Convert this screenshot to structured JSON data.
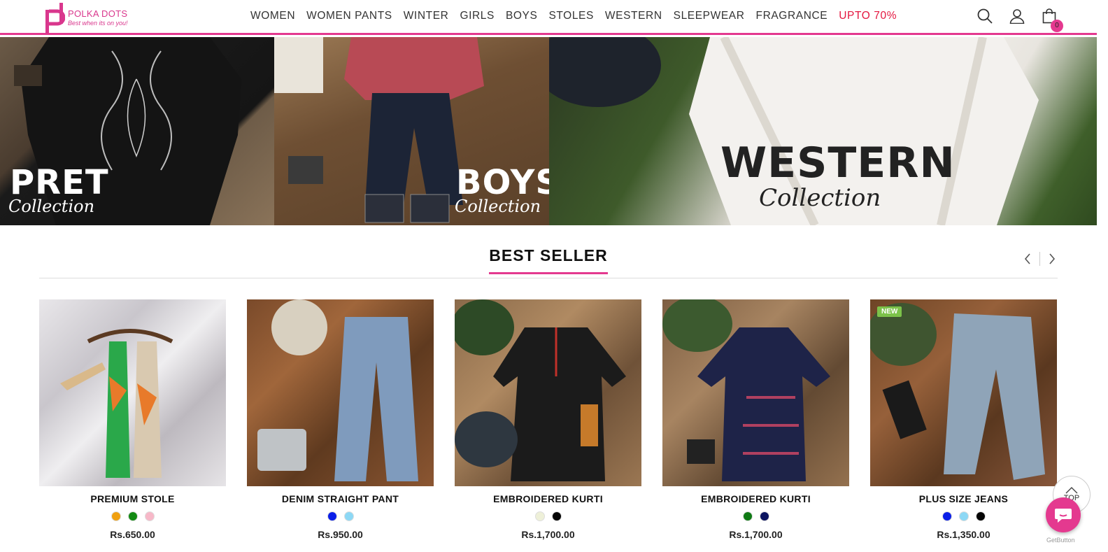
{
  "header": {
    "logo_name": "POLKA DOTS",
    "logo_tagline": "Best when its on you!",
    "nav": [
      {
        "label": "WOMEN"
      },
      {
        "label": "WOMEN PANTS"
      },
      {
        "label": "WINTER"
      },
      {
        "label": "GIRLS"
      },
      {
        "label": "BOYS"
      },
      {
        "label": "STOLES"
      },
      {
        "label": "WESTERN"
      },
      {
        "label": "SLEEPWEAR"
      },
      {
        "label": "FRAGRANCE"
      },
      {
        "label": "UPTO 70%"
      }
    ],
    "icons": [
      "search-icon",
      "user-icon",
      "cart-icon"
    ],
    "cart_count": "0",
    "accent_color": "#e4398f",
    "sale_color": "#e4163f"
  },
  "banners": [
    {
      "title": "PRET",
      "subtitle": "Collection"
    },
    {
      "title": "BOYS",
      "subtitle": "Collection"
    },
    {
      "title": "WESTERN",
      "subtitle": "Collection"
    }
  ],
  "section": {
    "title": "BEST SELLER",
    "prev_icon": "chevron-left-icon",
    "next_icon": "chevron-right-icon"
  },
  "products": [
    {
      "name": "PREMIUM STOLE",
      "price": "Rs.650.00",
      "badge": "",
      "swatches": [
        "#f0a010",
        "#138a13",
        "#f7b8c8"
      ]
    },
    {
      "name": "DENIM STRAIGHT PANT",
      "price": "Rs.950.00",
      "badge": "",
      "swatches": [
        "#0a1ee8",
        "#8dd8f5"
      ]
    },
    {
      "name": "EMBROIDERED KURTI",
      "price": "Rs.1,700.00",
      "badge": "",
      "swatches": [
        "#eef0d8",
        "#050505"
      ]
    },
    {
      "name": "EMBROIDERED KURTI",
      "price": "Rs.1,700.00",
      "badge": "",
      "swatches": [
        "#0f7a14",
        "#0c1460"
      ]
    },
    {
      "name": "PLUS SIZE JEANS",
      "price": "Rs.1,350.00",
      "badge": "NEW",
      "swatches": [
        "#0a1ee8",
        "#8dd8f5",
        "#050505"
      ]
    }
  ],
  "widgets": {
    "top_label": "TOP",
    "getbutton_label": "GetButton"
  }
}
